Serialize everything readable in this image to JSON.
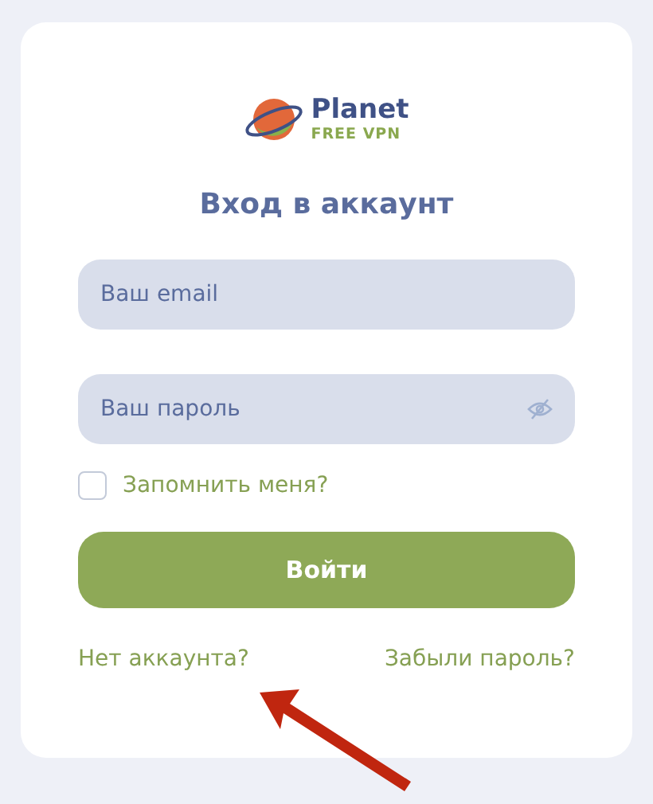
{
  "logo": {
    "name": "Planet",
    "tagline": "FREE VPN"
  },
  "title": "Вход в аккаунт",
  "fields": [
    {
      "kind": "email",
      "placeholder": "Ваш email"
    },
    {
      "kind": "password",
      "placeholder": "Ваш пароль"
    }
  ],
  "remember": {
    "label": "Запомнить меня?",
    "checked": false
  },
  "submit": "Войти",
  "links": [
    "Нет аккаунта?",
    "Забыли пароль?"
  ]
}
